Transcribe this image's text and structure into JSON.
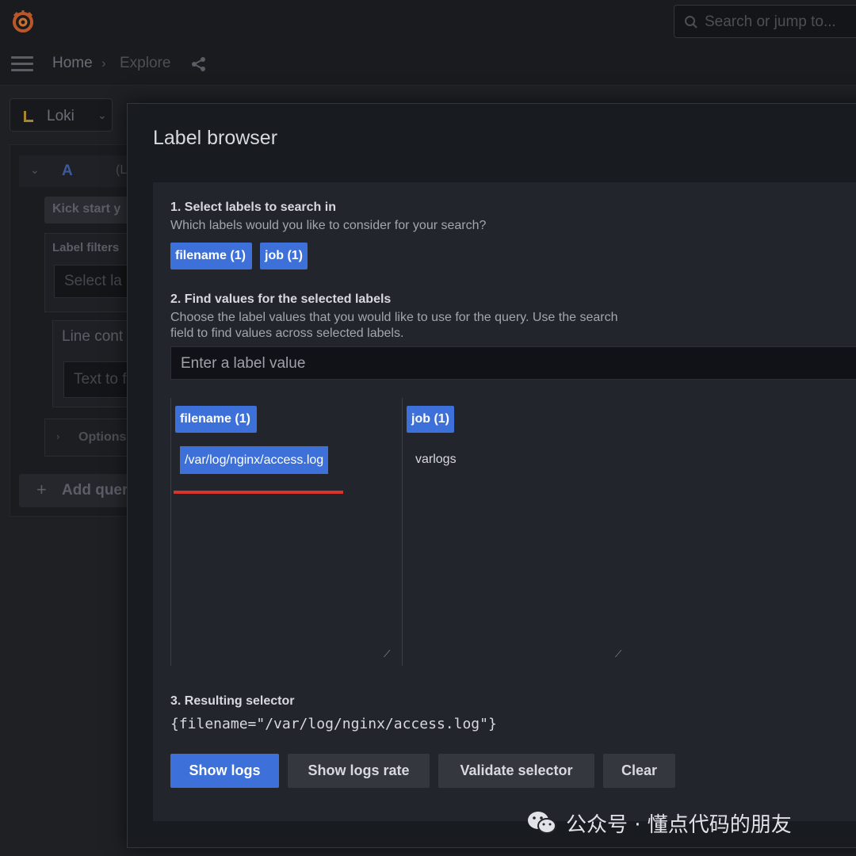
{
  "app": {
    "search_placeholder": "Search or jump to...",
    "breadcrumb": {
      "home": "Home",
      "separator": "›",
      "current": "Explore"
    },
    "datasource": "Loki",
    "query": {
      "letter": "A",
      "extra": "(L",
      "kick_start": "Kick start y",
      "label_filters_title": "Label filters",
      "label_select_placeholder": "Select la",
      "line_contains_title": "Line cont",
      "line_text_placeholder": "Text to f",
      "options_label": "Options",
      "add_query_label": "Add quer"
    }
  },
  "modal": {
    "title": "Label browser",
    "step1": {
      "title": "1. Select labels to search in",
      "description": "Which labels would you like to consider for your search?",
      "labels": [
        "filename (1)",
        "job (1)"
      ]
    },
    "step2": {
      "title": "2. Find values for the selected labels",
      "description_line1": "Choose the label values that you would like to use for the query. Use the search",
      "description_line2": "field to find values across selected labels.",
      "input_placeholder": "Enter a label value",
      "columns": [
        {
          "label": "filename (1)",
          "value": "/var/log/nginx/access.log",
          "selected": true
        },
        {
          "label": "job (1)",
          "value": "varlogs",
          "selected": false
        }
      ]
    },
    "step3": {
      "title": "3. Resulting selector",
      "selector": "{filename=\"/var/log/nginx/access.log\"}"
    },
    "buttons": {
      "show_logs": "Show logs",
      "show_logs_rate": "Show logs rate",
      "validate": "Validate selector",
      "clear": "Clear"
    }
  },
  "watermark": {
    "text": "公众号 · 懂点代码的朋友"
  },
  "colors": {
    "accent": "#3d71d9",
    "highlight_line": "#d9342b",
    "modal_bg": "#181b1f",
    "panel_bg": "#22252b"
  }
}
